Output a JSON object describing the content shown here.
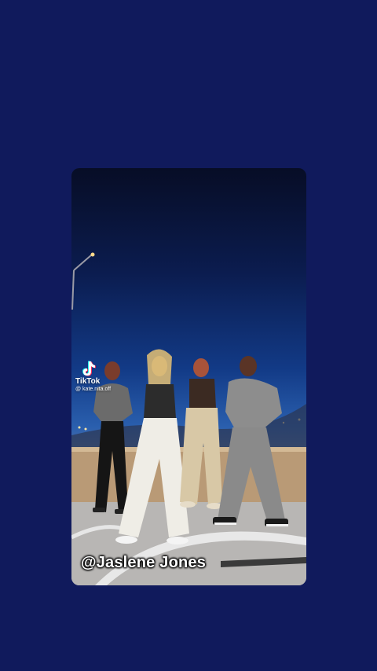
{
  "video": {
    "watermark_brand": "TikTok",
    "watermark_handle": "@ kate.nita.off",
    "credit_caption": "@Jaslene Jones"
  },
  "colors": {
    "background": "#101a5c",
    "caption_text": "#ffffff"
  },
  "icons": {
    "watermark": "tiktok-logo-icon"
  }
}
